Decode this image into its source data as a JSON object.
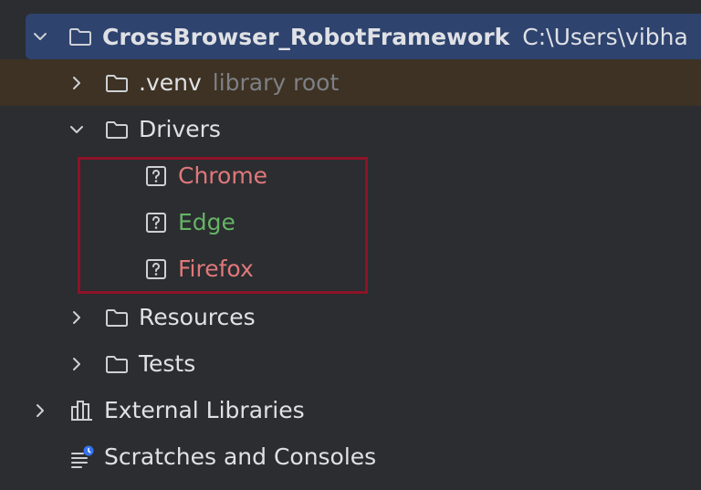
{
  "project_tree": {
    "root": {
      "name": "CrossBrowser_RobotFramework",
      "path": "C:\\Users\\vibha"
    },
    "items": [
      {
        "name": ".venv",
        "hint": "library root"
      },
      {
        "name": "Drivers"
      },
      {
        "name": "Resources"
      },
      {
        "name": "Tests"
      }
    ],
    "drivers": [
      {
        "name": "Chrome",
        "color": "#e0787a"
      },
      {
        "name": "Edge",
        "color": "#66b366"
      },
      {
        "name": "Firefox",
        "color": "#e0787a"
      }
    ],
    "external_libraries": "External Libraries",
    "scratches": "Scratches and Consoles"
  },
  "colors": {
    "background": "#2b2d30",
    "selection": "#2e436e",
    "library_root_row": "#3d3223",
    "highlight_border": "#8e1328",
    "unversioned_red": "#e0787a",
    "added_green": "#66b366"
  }
}
